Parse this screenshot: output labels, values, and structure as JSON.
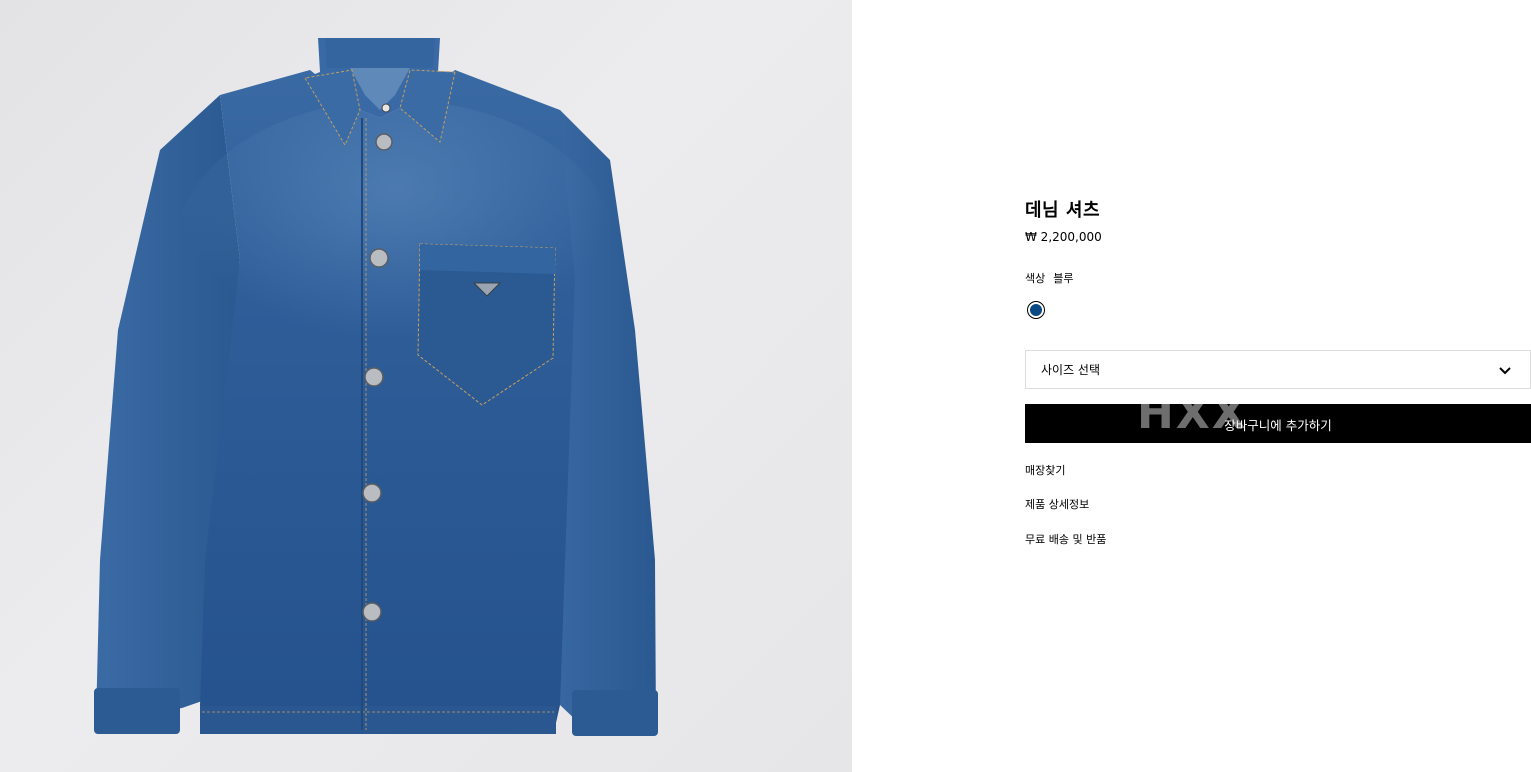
{
  "product": {
    "title": "데님 셔츠",
    "price": "₩ 2,200,000",
    "color_label": "색상",
    "color_value": "블루",
    "swatch_color": "#0c4a86",
    "size_select_placeholder": "사이즈 선택",
    "add_to_cart_label": "장바구니에 추가하기",
    "button_watermark": "HXX"
  },
  "links": {
    "store_finder": "매장찾기",
    "product_details": "제품 상세정보",
    "shipping_returns": "무료 배송 및 반품"
  },
  "icons": {
    "size_dropdown": "chevron-down-icon",
    "brand_plaque": "triangle-logo-icon"
  },
  "colors": {
    "denim": "#2f5d94",
    "image_background": "#e7e7e9",
    "button_background": "#000000"
  }
}
